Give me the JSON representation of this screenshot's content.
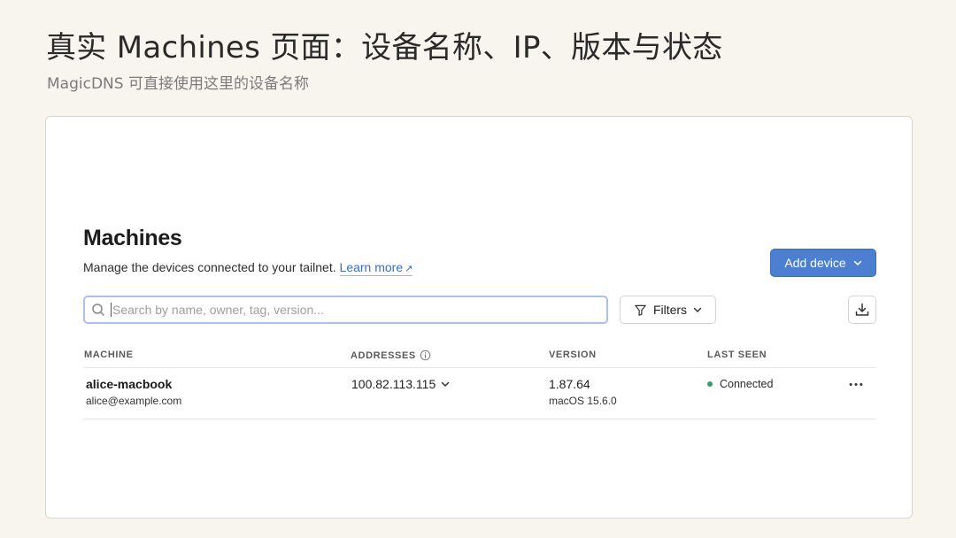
{
  "slide": {
    "title": "真实 Machines 页面：设备名称、IP、版本与状态",
    "subtitle": "MagicDNS 可直接使用这里的设备名称"
  },
  "page": {
    "heading": "Machines",
    "description": "Manage the devices connected to your tailnet.",
    "learn_more": "Learn more"
  },
  "actions": {
    "add_device": "Add device",
    "filters": "Filters"
  },
  "search": {
    "placeholder": "Search by name, owner, tag, version..."
  },
  "table": {
    "headers": {
      "machine": "MACHINE",
      "addresses": "ADDRESSES",
      "version": "VERSION",
      "last_seen": "LAST SEEN"
    },
    "rows": [
      {
        "name": "alice-macbook",
        "owner": "alice@example.com",
        "address": "100.82.113.115",
        "version": "1.87.64",
        "os": "macOS 15.6.0",
        "last_seen": "Connected"
      }
    ]
  },
  "colors": {
    "accent": "#4d7fd1",
    "connected": "#3a9b6d",
    "background": "#f8f5ef"
  },
  "icons": [
    "search-icon",
    "filter-icon",
    "chevron-down-icon",
    "download-icon",
    "info-icon",
    "external-link-icon",
    "more-icon"
  ]
}
